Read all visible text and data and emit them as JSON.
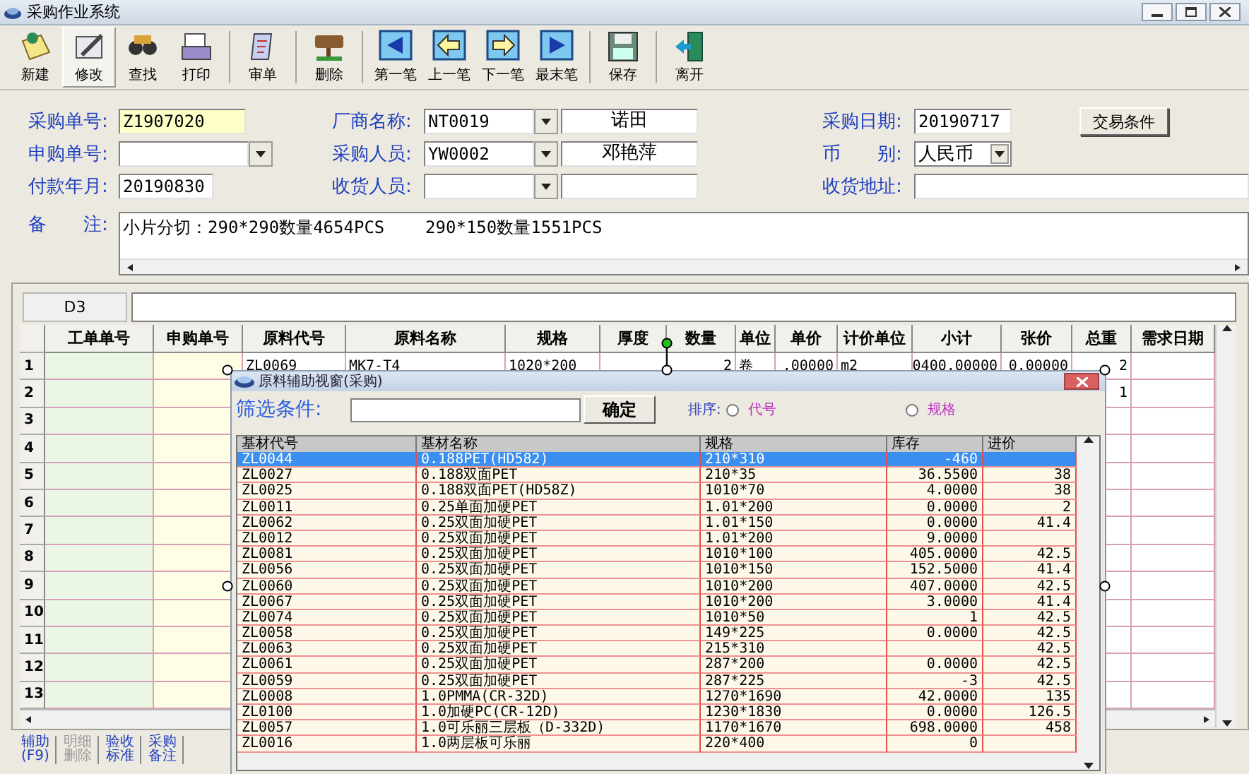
{
  "window": {
    "title": "采购作业系统"
  },
  "toolbar": [
    {
      "label": "新建",
      "kind": "new",
      "selected": false,
      "separator_after": false
    },
    {
      "label": "修改",
      "kind": "edit",
      "selected": true,
      "separator_after": false
    },
    {
      "label": "查找",
      "kind": "find",
      "selected": false,
      "separator_after": false
    },
    {
      "label": "打印",
      "kind": "print",
      "selected": false,
      "separator_after": true
    },
    {
      "label": "审单",
      "kind": "audit",
      "selected": false,
      "separator_after": true
    },
    {
      "label": "删除",
      "kind": "delete",
      "selected": false,
      "separator_after": true
    },
    {
      "label": "第一笔",
      "kind": "first",
      "selected": false,
      "separator_after": false
    },
    {
      "label": "上一笔",
      "kind": "prev",
      "selected": false,
      "separator_after": false
    },
    {
      "label": "下一笔",
      "kind": "next",
      "selected": false,
      "separator_after": false
    },
    {
      "label": "最末笔",
      "kind": "last",
      "selected": false,
      "separator_after": true
    },
    {
      "label": "保存",
      "kind": "save",
      "selected": false,
      "separator_after": true
    },
    {
      "label": "离开",
      "kind": "exit",
      "selected": false,
      "separator_after": false
    }
  ],
  "form": {
    "purchase_no": {
      "label": "采购单号:",
      "value": "Z1907020"
    },
    "vendor": {
      "label": "厂商名称:",
      "code": "NT0019",
      "name": "诺田"
    },
    "purchase_date": {
      "label": "采购日期:",
      "value": "20190717"
    },
    "terms_button": "交易条件",
    "request_no": {
      "label": "申购单号:"
    },
    "buyer": {
      "label": "采购人员:",
      "code": "YW0002",
      "name": "邓艳萍"
    },
    "currency": {
      "label": "币　　别:",
      "value": "人民币"
    },
    "pay_month": {
      "label": "付款年月:",
      "value": "20190830"
    },
    "receiver": {
      "label": "收货人员:"
    },
    "address": {
      "label": "收货地址:"
    },
    "note": {
      "label": "备　　注:",
      "value": "小片分切：290*290数量4654PCS    290*150数量1551PCS"
    }
  },
  "grid": {
    "cell_ref": "D3",
    "columns": [
      "工单单号",
      "申购单号",
      "原料代号",
      "原料名称",
      "规格",
      "厚度",
      "数量",
      "单位",
      "单价",
      "计价单位",
      "小计",
      "张价",
      "总重",
      "需求日期"
    ],
    "rows": [
      {
        "number": "1",
        "cells": [
          null,
          null,
          "ZL0069",
          "MK7-T4",
          "1020*200",
          null,
          "2",
          "卷",
          ".00000",
          "m2",
          "0400.00000",
          "0.00000",
          "2",
          null
        ]
      },
      {
        "number": "2",
        "cells": [
          null,
          null,
          null,
          null,
          null,
          null,
          null,
          null,
          null,
          null,
          null,
          null,
          "1",
          null
        ]
      },
      {
        "number": "3"
      },
      {
        "number": "4"
      },
      {
        "number": "5"
      },
      {
        "number": "6"
      },
      {
        "number": "7"
      },
      {
        "number": "8"
      },
      {
        "number": "9"
      },
      {
        "number": "10"
      },
      {
        "number": "11"
      },
      {
        "number": "12"
      },
      {
        "number": "13"
      }
    ]
  },
  "dialog": {
    "title": "原料辅助视窗(采购)",
    "filter_label": "筛选条件:",
    "confirm_button": "确定",
    "sort_label": "排序:",
    "sort_options": [
      {
        "label": "代号",
        "selected": false
      },
      {
        "label": "规格",
        "selected": false
      }
    ],
    "columns": [
      "基材代号",
      "基材名称",
      "规格",
      "库存",
      "进价"
    ],
    "rows": [
      {
        "cells": [
          "ZL0044",
          "0.188PET(HD582)",
          "210*310",
          "-460",
          null
        ],
        "selected": true
      },
      {
        "cells": [
          "ZL0027",
          "0.188双面PET",
          "210*35",
          "36.5500",
          "38"
        ],
        "selected": false
      },
      {
        "cells": [
          "ZL0025",
          "0.188双面PET(HD58Z)",
          "1010*70",
          "4.0000",
          "38"
        ],
        "selected": false
      },
      {
        "cells": [
          "ZL0011",
          "0.25单面加硬PET",
          "1.01*200",
          "0.0000",
          "2"
        ],
        "selected": false
      },
      {
        "cells": [
          "ZL0062",
          "0.25双面加硬PET",
          "1.01*150",
          "0.0000",
          "41.4"
        ],
        "selected": false
      },
      {
        "cells": [
          "ZL0012",
          "0.25双面加硬PET",
          "1.01*200",
          "9.0000",
          null
        ],
        "selected": false
      },
      {
        "cells": [
          "ZL0081",
          "0.25双面加硬PET",
          "1010*100",
          "405.0000",
          "42.5"
        ],
        "selected": false
      },
      {
        "cells": [
          "ZL0056",
          "0.25双面加硬PET",
          "1010*150",
          "152.5000",
          "41.4"
        ],
        "selected": false
      },
      {
        "cells": [
          "ZL0060",
          "0.25双面加硬PET",
          "1010*200",
          "407.0000",
          "42.5"
        ],
        "selected": false
      },
      {
        "cells": [
          "ZL0067",
          "0.25双面加硬PET",
          "1010*200",
          "3.0000",
          "41.4"
        ],
        "selected": false
      },
      {
        "cells": [
          "ZL0074",
          "0.25双面加硬PET",
          "1010*50",
          "1",
          "42.5"
        ],
        "selected": false
      },
      {
        "cells": [
          "ZL0058",
          "0.25双面加硬PET",
          "149*225",
          "0.0000",
          "42.5"
        ],
        "selected": false
      },
      {
        "cells": [
          "ZL0063",
          "0.25双面加硬PET",
          "215*310",
          null,
          "42.5"
        ],
        "selected": false
      },
      {
        "cells": [
          "ZL0061",
          "0.25双面加硬PET",
          "287*200",
          "0.0000",
          "42.5"
        ],
        "selected": false
      },
      {
        "cells": [
          "ZL0059",
          "0.25双面加硬PET",
          "287*225",
          "-3",
          "42.5"
        ],
        "selected": false
      },
      {
        "cells": [
          "ZL0008",
          "1.0PMMA(CR-32D)",
          "1270*1690",
          "42.0000",
          "135"
        ],
        "selected": false
      },
      {
        "cells": [
          "ZL0100",
          "1.0加硬PC(CR-12D)",
          "1230*1830",
          "0.0000",
          "126.5"
        ],
        "selected": false
      },
      {
        "cells": [
          "ZL0057",
          "1.0可乐丽三层板（D-332D)",
          "1170*1670",
          "698.0000",
          "458"
        ],
        "selected": false
      },
      {
        "cells": [
          "ZL0016",
          "1.0两层板可乐丽",
          "220*400",
          "0",
          null
        ],
        "selected": false
      }
    ]
  },
  "bottom_tabs": [
    {
      "label": "辅助(F9)",
      "disabled": false
    },
    {
      "label": "明细删除",
      "disabled": true
    },
    {
      "label": "验收标准",
      "disabled": false
    },
    {
      "label": "采购备注",
      "disabled": false
    }
  ]
}
